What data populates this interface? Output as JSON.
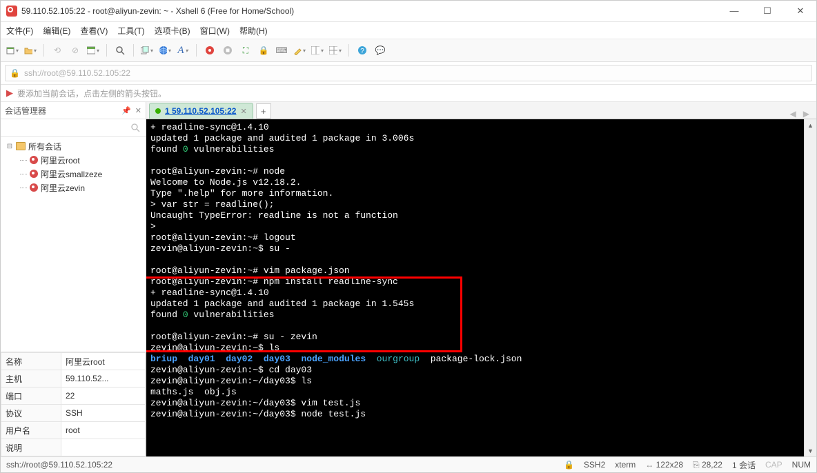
{
  "window": {
    "title": "59.110.52.105:22 - root@aliyun-zevin: ~ - Xshell 6 (Free for Home/School)"
  },
  "menu": {
    "file": "文件(F)",
    "edit": "编辑(E)",
    "view": "查看(V)",
    "tools": "工具(T)",
    "tabs": "选项卡(B)",
    "window": "窗口(W)",
    "help": "帮助(H)"
  },
  "addressbar": {
    "url": "ssh://root@59.110.52.105:22"
  },
  "hint": {
    "text": "要添加当前会话，点击左侧的箭头按钮。"
  },
  "side": {
    "title": "会话管理器",
    "root": "所有会话",
    "items": [
      "阿里云root",
      "阿里云smallzeze",
      "阿里云zevin"
    ]
  },
  "props": {
    "l_name": "名称",
    "v_name": "阿里云root",
    "l_host": "主机",
    "v_host": "59.110.52...",
    "l_port": "端口",
    "v_port": "22",
    "l_proto": "协议",
    "v_proto": "SSH",
    "l_user": "用户名",
    "v_user": "root",
    "l_desc": "说明",
    "v_desc": ""
  },
  "tab": {
    "label": "1 59.110.52.105:22"
  },
  "term": {
    "l1": "+ readline-sync@1.4.10",
    "l2": "updated 1 package and audited 1 package in 3.006s",
    "l3a": "found ",
    "l3b": "0",
    "l3c": " vulnerabilities",
    "l4": "",
    "l5": "root@aliyun-zevin:~# node",
    "l6": "Welcome to Node.js v12.18.2.",
    "l7": "Type \".help\" for more information.",
    "l8": "> var str = readline();",
    "l9": "Uncaught TypeError: readline is not a function",
    "l10": "> ",
    "l11": "root@aliyun-zevin:~# logout",
    "l12": "zevin@aliyun-zevin:~$ su -",
    "l13": "",
    "l14": "root@aliyun-zevin:~# vim package.json",
    "l15": "root@aliyun-zevin:~# npm install readline-sync",
    "l16": "+ readline-sync@1.4.10",
    "l17": "updated 1 package and audited 1 package in 1.545s",
    "l18a": "found ",
    "l18b": "0",
    "l18c": " vulnerabilities",
    "l19": "",
    "l20": "root@aliyun-zevin:~# su - zevin",
    "l21": "zevin@aliyun-zevin:~$ ls",
    "l22a": "briup",
    "l22b": "day01",
    "l22c": "day02",
    "l22d": "day03",
    "l22e": "node_modules",
    "l22f": "ourgroup",
    "l22g": "package-lock.json",
    "l23": "zevin@aliyun-zevin:~$ cd day03",
    "l24": "zevin@aliyun-zevin:~/day03$ ls",
    "l25": "maths.js  obj.js",
    "l26": "zevin@aliyun-zevin:~/day03$ vim test.js",
    "l27": "zevin@aliyun-zevin:~/day03$ node test.js"
  },
  "status": {
    "url": "ssh://root@59.110.52.105:22",
    "ssh": "SSH2",
    "xterm": "xterm",
    "size": "122x28",
    "pos": "28,22",
    "sess": "1 会话",
    "cap": "CAP",
    "num": "NUM"
  }
}
